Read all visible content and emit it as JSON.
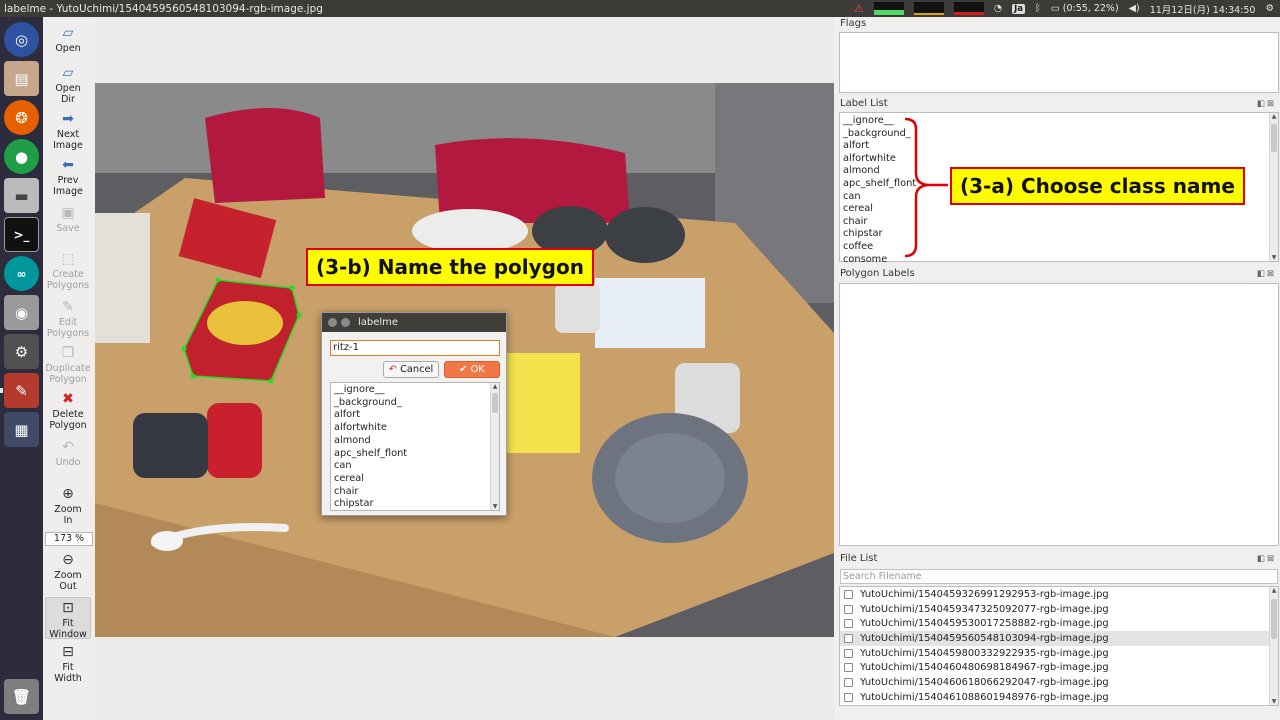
{
  "window": {
    "title": "labelme - YutoUchimi/1540459560548103094-rgb-image.jpg"
  },
  "system_tray": {
    "ime": "Ja",
    "battery": "(0:55, 22%)",
    "datetime": "11月12日(月) 14:34:50"
  },
  "toolbar": {
    "open": "Open",
    "open_dir_1": "Open",
    "open_dir_2": "Dir",
    "next_1": "Next",
    "next_2": "Image",
    "prev_1": "Prev",
    "prev_2": "Image",
    "save": "Save",
    "create_1": "Create",
    "create_2": "Polygons",
    "edit_1": "Edit",
    "edit_2": "Polygons",
    "dup_1": "Duplicate",
    "dup_2": "Polygon",
    "del_1": "Delete",
    "del_2": "Polygon",
    "undo": "Undo",
    "zin_1": "Zoom",
    "zin_2": "In",
    "zoom_value": "173 %",
    "zout_1": "Zoom",
    "zout_2": "Out",
    "fitw_1": "Fit",
    "fitw_2": "Window",
    "fitwd_1": "Fit",
    "fitwd_2": "Width"
  },
  "panels": {
    "flags_title": "Flags",
    "label_list_title": "Label List",
    "polygon_labels_title": "Polygon Labels",
    "file_list_title": "File List"
  },
  "label_list": [
    "__ignore__",
    "_background_",
    "alfort",
    "alfortwhite",
    "almond",
    "apc_shelf_flont",
    "can",
    "cereal",
    "chair",
    "chipstar",
    "coffee",
    "consome"
  ],
  "file_search_placeholder": "Search Filename",
  "file_list": [
    "YutoUchimi/1540459326991292953-rgb-image.jpg",
    "YutoUchimi/1540459347325092077-rgb-image.jpg",
    "YutoUchimi/1540459530017258882-rgb-image.jpg",
    "YutoUchimi/1540459560548103094-rgb-image.jpg",
    "YutoUchimi/1540459800332922935-rgb-image.jpg",
    "YutoUchimi/1540460480698184967-rgb-image.jpg",
    "YutoUchimi/1540460618066292047-rgb-image.jpg",
    "YutoUchimi/1540461088601948976-rgb-image.jpg"
  ],
  "selected_file_index": 3,
  "dialog": {
    "title": "labelme",
    "input_value": "ritz-1",
    "cancel": "Cancel",
    "ok": "OK",
    "options": [
      "__ignore__",
      "_background_",
      "alfort",
      "alfortwhite",
      "almond",
      "apc_shelf_flont",
      "can",
      "cereal",
      "chair",
      "chipstar"
    ]
  },
  "callouts": {
    "choose": "(3-a) Choose class name",
    "name": "(3-b) Name the polygon"
  },
  "colors": {
    "accent": "#f07746",
    "callout_bg": "#fffb00",
    "callout_border": "#e00000",
    "polygon": "#22dd22"
  }
}
